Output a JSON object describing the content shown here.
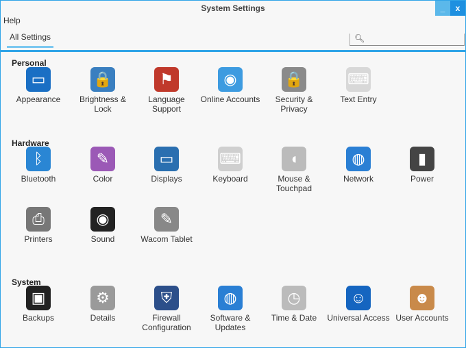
{
  "window": {
    "title": "System Settings",
    "minimize": "_",
    "close": "x"
  },
  "menu": {
    "help": "Help"
  },
  "toolbar": {
    "tab": "All Settings",
    "search_icon": "search-icon",
    "search_placeholder": ""
  },
  "sections": [
    {
      "title": "Personal",
      "items": [
        {
          "label": "Appearance",
          "icon": "monitor-icon",
          "color": "#1a6fc4",
          "glyph": "▭"
        },
        {
          "label": "Brightness & Lock",
          "icon": "brightness-lock-icon",
          "color": "#3a7fc0",
          "glyph": "🔒"
        },
        {
          "label": "Language Support",
          "icon": "flags-icon",
          "color": "#c0392b",
          "glyph": "⚑"
        },
        {
          "label": "Online Accounts",
          "icon": "online-accounts-icon",
          "color": "#3d9be0",
          "glyph": "◉"
        },
        {
          "label": "Security & Privacy",
          "icon": "padlock-icon",
          "color": "#8a8a8a",
          "glyph": "🔒"
        },
        {
          "label": "Text Entry",
          "icon": "keys-icon",
          "color": "#d8d8d8",
          "glyph": "⌨"
        }
      ]
    },
    {
      "title": "Hardware",
      "items": [
        {
          "label": "Bluetooth",
          "icon": "bluetooth-icon",
          "color": "#2a86d4",
          "glyph": "ᛒ"
        },
        {
          "label": "Color",
          "icon": "color-icon",
          "color": "#9b59b6",
          "glyph": "✎"
        },
        {
          "label": "Displays",
          "icon": "display-icon",
          "color": "#2a6fb0",
          "glyph": "▭"
        },
        {
          "label": "Keyboard",
          "icon": "keyboard-icon",
          "color": "#cfcfcf",
          "glyph": "⌨"
        },
        {
          "label": "Mouse & Touchpad",
          "icon": "mouse-icon",
          "color": "#bbbbbb",
          "glyph": "◖"
        },
        {
          "label": "Network",
          "icon": "network-icon",
          "color": "#2a7fd4",
          "glyph": "◍"
        },
        {
          "label": "Power",
          "icon": "battery-icon",
          "color": "#444444",
          "glyph": "▮"
        },
        {
          "label": "Printers",
          "icon": "printer-icon",
          "color": "#777777",
          "glyph": "⎙"
        },
        {
          "label": "Sound",
          "icon": "speaker-icon",
          "color": "#222222",
          "glyph": "◉"
        },
        {
          "label": "Wacom Tablet",
          "icon": "tablet-icon",
          "color": "#888888",
          "glyph": "✎"
        }
      ]
    },
    {
      "title": "System",
      "items": [
        {
          "label": "Backups",
          "icon": "safe-icon",
          "color": "#222222",
          "glyph": "▣"
        },
        {
          "label": "Details",
          "icon": "gears-icon",
          "color": "#9a9a9a",
          "glyph": "⚙"
        },
        {
          "label": "Firewall Configuration",
          "icon": "shield-icon",
          "color": "#2c4f8a",
          "glyph": "⛨"
        },
        {
          "label": "Software & Updates",
          "icon": "globe-icon",
          "color": "#2a7fd4",
          "glyph": "◍"
        },
        {
          "label": "Time & Date",
          "icon": "clock-icon",
          "color": "#bbbbbb",
          "glyph": "◷"
        },
        {
          "label": "Universal Access",
          "icon": "accessibility-icon",
          "color": "#1565c0",
          "glyph": "☺"
        },
        {
          "label": "User Accounts",
          "icon": "users-icon",
          "color": "#c98a4a",
          "glyph": "☻"
        }
      ]
    }
  ]
}
